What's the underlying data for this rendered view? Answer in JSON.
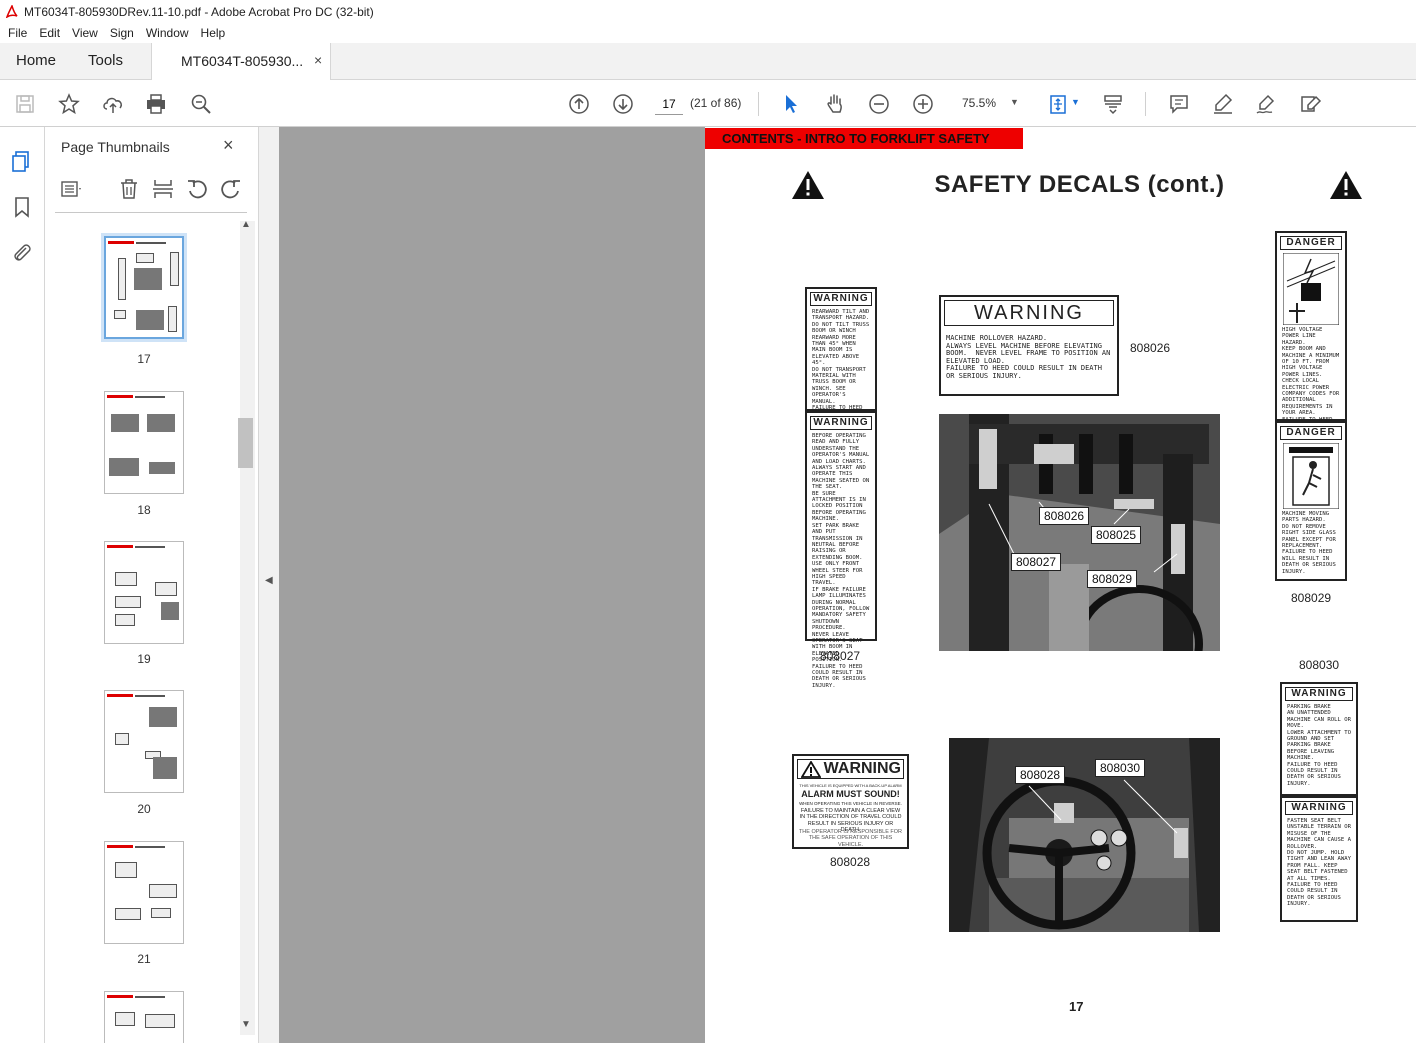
{
  "window": {
    "title": "MT6034T-805930DRev.11-10.pdf - Adobe Acrobat Pro DC (32-bit)"
  },
  "menu": [
    "File",
    "Edit",
    "View",
    "Sign",
    "Window",
    "Help"
  ],
  "tabs": {
    "home": "Home",
    "tools": "Tools",
    "document": "MT6034T-805930...",
    "close": "×"
  },
  "toolbar": {
    "page_value": "17",
    "page_count": "(21 of 86)",
    "zoom": "75.5%",
    "icons": [
      "save-icon",
      "star-icon",
      "upload-icon",
      "print-icon",
      "find-icon",
      "prev-page-icon",
      "next-page-icon",
      "select-cursor-icon",
      "hand-icon",
      "zoom-out-icon",
      "zoom-in-icon",
      "fit-page-icon",
      "scroll-mode-icon",
      "comment-icon",
      "highlight-icon",
      "sign-icon",
      "edit-icon"
    ]
  },
  "panel": {
    "title": "Page Thumbnails",
    "close": "×",
    "thumbnails": [
      {
        "label": "17",
        "selected": true
      },
      {
        "label": "18",
        "selected": false
      },
      {
        "label": "19",
        "selected": false
      },
      {
        "label": "20",
        "selected": false
      },
      {
        "label": "21",
        "selected": false
      },
      {
        "label": "",
        "selected": false
      }
    ]
  },
  "page": {
    "header_bar": "CONTENTS - INTRO TO FORKLIFT SAFETY",
    "heading": "SAFETY DECALS (cont.)",
    "page_number": "17",
    "decals": {
      "d808027": {
        "code": "808027",
        "top_header": "WARNING",
        "top_text": "REARWARD TILT AND TRANSPORT HAZARD.\nDO NOT TILT TRUSS BOOM OR WINCH REARWARD MORE THAN 45° WHEN MAIN BOOM IS ELEVATED ABOVE 45°.\nDO NOT TRANSPORT MATERIAL WITH TRUSS BOOM OR WINCH. SEE OPERATOR'S MANUAL.\nFAILURE TO HEED COULD RESULT IN DEATH OR SERIOUS INJURY.",
        "bottom_header": "WARNING",
        "bottom_text": "BEFORE OPERATING READ AND FULLY UNDERSTAND THE OPERATOR'S MANUAL AND LOAD CHARTS.\nALWAYS START AND OPERATE THIS MACHINE SEATED ON THE SEAT.\nBE SURE ATTACHMENT IS IN LOCKED POSITION BEFORE OPERATING MACHINE.\nSET PARK BRAKE AND PUT TRANSMISSION IN NEUTRAL BEFORE RAISING OR EXTENDING BOOM.\nUSE ONLY FRONT WHEEL STEER FOR HIGH SPEED TRAVEL.\nIF BRAKE FAILURE LAMP ILLUMINATES DURING NORMAL OPERATION, FOLLOW MANDATORY SAFETY SHUTDOWN PROCEDURE.\nNEVER LEAVE OPERATOR'S SEAT WITH BOOM IN ELEVATED POSITION.\nFAILURE TO HEED COULD RESULT IN DEATH OR SERIOUS INJURY."
      },
      "d808026": {
        "code": "808026",
        "header": "WARNING",
        "text": "MACHINE ROLLOVER HAZARD.\nALWAYS LEVEL MACHINE BEFORE ELEVATING BOOM.  NEVER LEVEL FRAME TO POSITION AN ELEVATED LOAD.\nFAILURE TO HEED COULD RESULT IN DEATH OR SERIOUS INJURY."
      },
      "d808029": {
        "code": "808029",
        "top_header": "DANGER",
        "top_text": "HIGH VOLTAGE POWER LINE HAZARD.\nKEEP BOOM AND MACHINE A MINIMUM OF 10 FT. FROM HIGH VOLTAGE POWER LINES. CHECK LOCAL ELECTRIC POWER COMPANY CODES FOR ADDITIONAL REQUIREMENTS IN YOUR AREA.\nFAILURE TO HEED WILL RESULT IN DEATH OR SERIOUS INJURY.",
        "bottom_header": "DANGER",
        "bottom_text": "MACHINE MOVING PARTS HAZARD.\nDO NOT REMOVE RIGHT SIDE GLASS PANEL EXCEPT FOR REPLACEMENT.\nFAILURE TO HEED WILL RESULT IN DEATH OR SERIOUS INJURY."
      },
      "d808030": {
        "code": "808030",
        "top_header": "WARNING",
        "top_text": "PARKING BRAKE\nAN UNATTENDED MACHINE CAN ROLL OR MOVE.\nLOWER ATTACHMENT TO GROUND AND SET PARKING BRAKE BEFORE LEAVING MACHINE.\nFAILURE TO HEED COULD RESULT IN DEATH OR SERIOUS INJURY.",
        "bottom_header": "WARNING",
        "bottom_text": "FASTEN SEAT BELT\nUNSTABLE TERRAIN OR MISUSE OF THE MACHINE CAN CAUSE A ROLLOVER.\nDO NOT JUMP. HOLD TIGHT AND LEAN AWAY FROM FALL. KEEP SEAT BELT FASTENED AT ALL TIMES.\nFAILURE TO HEED COULD RESULT IN DEATH OR SERIOUS INJURY."
      },
      "d808028": {
        "code": "808028",
        "header": "WARNING",
        "line1": "THIS VEHICLE IS EQUIPPED WITH A BACK-UP ALARM",
        "alarm": "ALARM MUST SOUND!",
        "line2": "WHEN OPERATING THIS VEHICLE IN REVERSE.",
        "line3": "FAILURE TO MAINTAIN A CLEAR VIEW IN THE DIRECTION OF TRAVEL COULD RESULT IN SERIOUS INJURY OR DEATH.",
        "line4": "THE OPERATOR IS RESPONSIBLE FOR THE SAFE OPERATION OF THIS VEHICLE."
      }
    },
    "photo1_callouts": [
      "808026",
      "808025",
      "808027",
      "808029"
    ],
    "photo2_callouts": [
      "808028",
      "808030"
    ]
  }
}
